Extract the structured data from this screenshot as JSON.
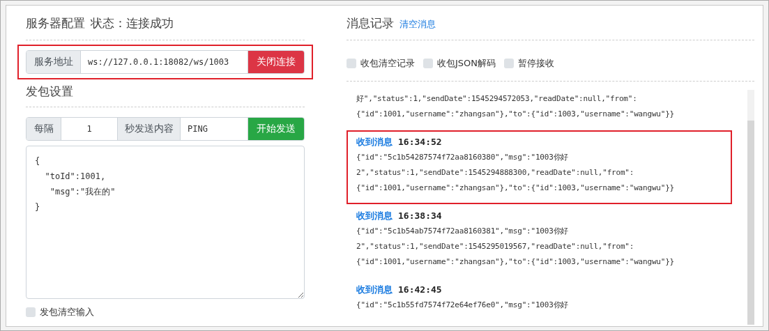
{
  "server_config": {
    "title": "服务器配置",
    "status": "状态：连接成功"
  },
  "address": {
    "label": "服务地址",
    "value": "ws://127.0.0.1:18082/ws/1003",
    "button": "关闭连接",
    "highlighted": true
  },
  "send_settings": {
    "title": "发包设置",
    "interval_label": "每隔",
    "interval_value": "1",
    "content_label": "秒发送内容",
    "content_value": "PING",
    "button": "开始发送",
    "body": "{\n  \"toId\":1001,\n   \"msg\":\"我在的\"\n}",
    "clear_input": {
      "label": "发包清空输入",
      "checked": false
    }
  },
  "message_log": {
    "title": "消息记录",
    "clear_link": "清空消息",
    "options": [
      {
        "label": "收包清空记录",
        "checked": false
      },
      {
        "label": "收包JSON解码",
        "checked": false
      },
      {
        "label": "暂停接收",
        "checked": false
      }
    ],
    "messages": [
      {
        "lines": [
          "好\",\"status\":1,\"sendDate\":1545294572053,\"readDate\":null,\"from\":",
          "{\"id\":1001,\"username\":\"zhangsan\"},\"to\":{\"id\":1003,\"username\":\"wangwu\"}}"
        ],
        "highlighted": false
      },
      {
        "label": "收到消息",
        "time": "16:34:52",
        "lines": [
          "{\"id\":\"5c1b54287574f72aa8160380\",\"msg\":\"1003你好",
          "2\",\"status\":1,\"sendDate\":1545294888300,\"readDate\":null,\"from\":",
          "{\"id\":1001,\"username\":\"zhangsan\"},\"to\":{\"id\":1003,\"username\":\"wangwu\"}}"
        ],
        "highlighted": true
      },
      {
        "label": "收到消息",
        "time": "16:38:34",
        "lines": [
          "{\"id\":\"5c1b54ab7574f72aa8160381\",\"msg\":\"1003你好",
          "2\",\"status\":1,\"sendDate\":1545295019567,\"readDate\":null,\"from\":",
          "{\"id\":1001,\"username\":\"zhangsan\"},\"to\":{\"id\":1003,\"username\":\"wangwu\"}}"
        ],
        "highlighted": false
      },
      {
        "label": "收到消息",
        "time": "16:42:45",
        "lines": [
          "{\"id\":\"5c1b55fd7574f72e64ef76e0\",\"msg\":\"1003你好"
        ],
        "highlighted": false
      }
    ]
  }
}
